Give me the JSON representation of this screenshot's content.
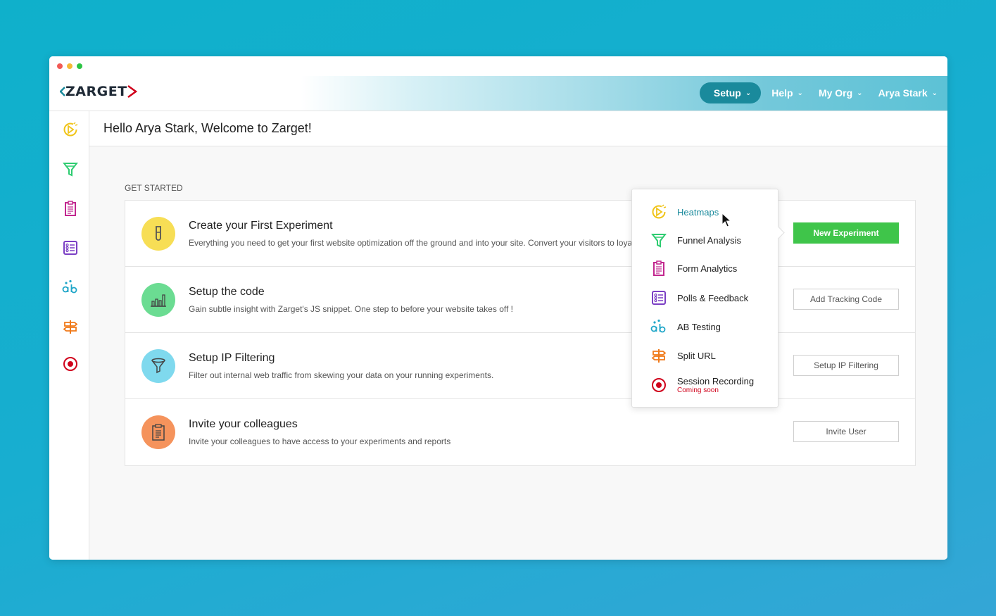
{
  "logo": {
    "text": "ZARGET"
  },
  "nav": {
    "items": [
      {
        "label": "Setup",
        "active": true
      },
      {
        "label": "Help"
      },
      {
        "label": "My Org"
      },
      {
        "label": "Arya Stark"
      }
    ]
  },
  "sidebar": {
    "icons": [
      "heatmap-icon",
      "funnel-icon",
      "form-icon",
      "polls-icon",
      "ab-testing-icon",
      "split-url-icon",
      "session-recording-icon"
    ]
  },
  "main": {
    "welcome": "Hello Arya Stark, Welcome to Zarget!",
    "section_label": "GET STARTED",
    "cards": [
      {
        "title": "Create your First Experiment",
        "description": "Everything you need to get your first website optimization off the ground and into your site. Convert your visitors to loyal customers",
        "button": "New Experiment",
        "icon": "test-tube-icon"
      },
      {
        "title": "Setup the code",
        "description": "Gain subtle insight with Zarget's JS snippet. One step to before your website takes off !",
        "button": "Add Tracking Code",
        "icon": "bar-chart-icon"
      },
      {
        "title": "Setup IP Filtering",
        "description": "Filter out internal web traffic from skewing your data on your running experiments.",
        "button": "Setup IP Filtering",
        "icon": "filter-icon"
      },
      {
        "title": "Invite your colleagues",
        "description": "Invite your colleagues to have access to your experiments and reports",
        "button": "Invite User",
        "icon": "clipboard-icon"
      }
    ]
  },
  "dropdown": {
    "items": [
      {
        "label": "Heatmaps",
        "icon": "heatmap-icon"
      },
      {
        "label": "Funnel Analysis",
        "icon": "funnel-icon"
      },
      {
        "label": "Form Analytics",
        "icon": "form-icon"
      },
      {
        "label": "Polls & Feedback",
        "icon": "polls-icon"
      },
      {
        "label": "AB Testing",
        "icon": "ab-testing-icon"
      },
      {
        "label": "Split URL",
        "icon": "split-url-icon"
      },
      {
        "label": "Session Recording",
        "sub": "Coming soon",
        "icon": "session-recording-icon"
      }
    ]
  },
  "colors": {
    "heatmap": "#f0c419",
    "funnel": "#2ecc71",
    "form": "#c2278f",
    "polls": "#7b3fc4",
    "ab": "#1fa6c8",
    "split": "#f07a1a",
    "session": "#d0021b",
    "primary_button": "#3fc54a",
    "active_nav": "#1a8a9c"
  }
}
